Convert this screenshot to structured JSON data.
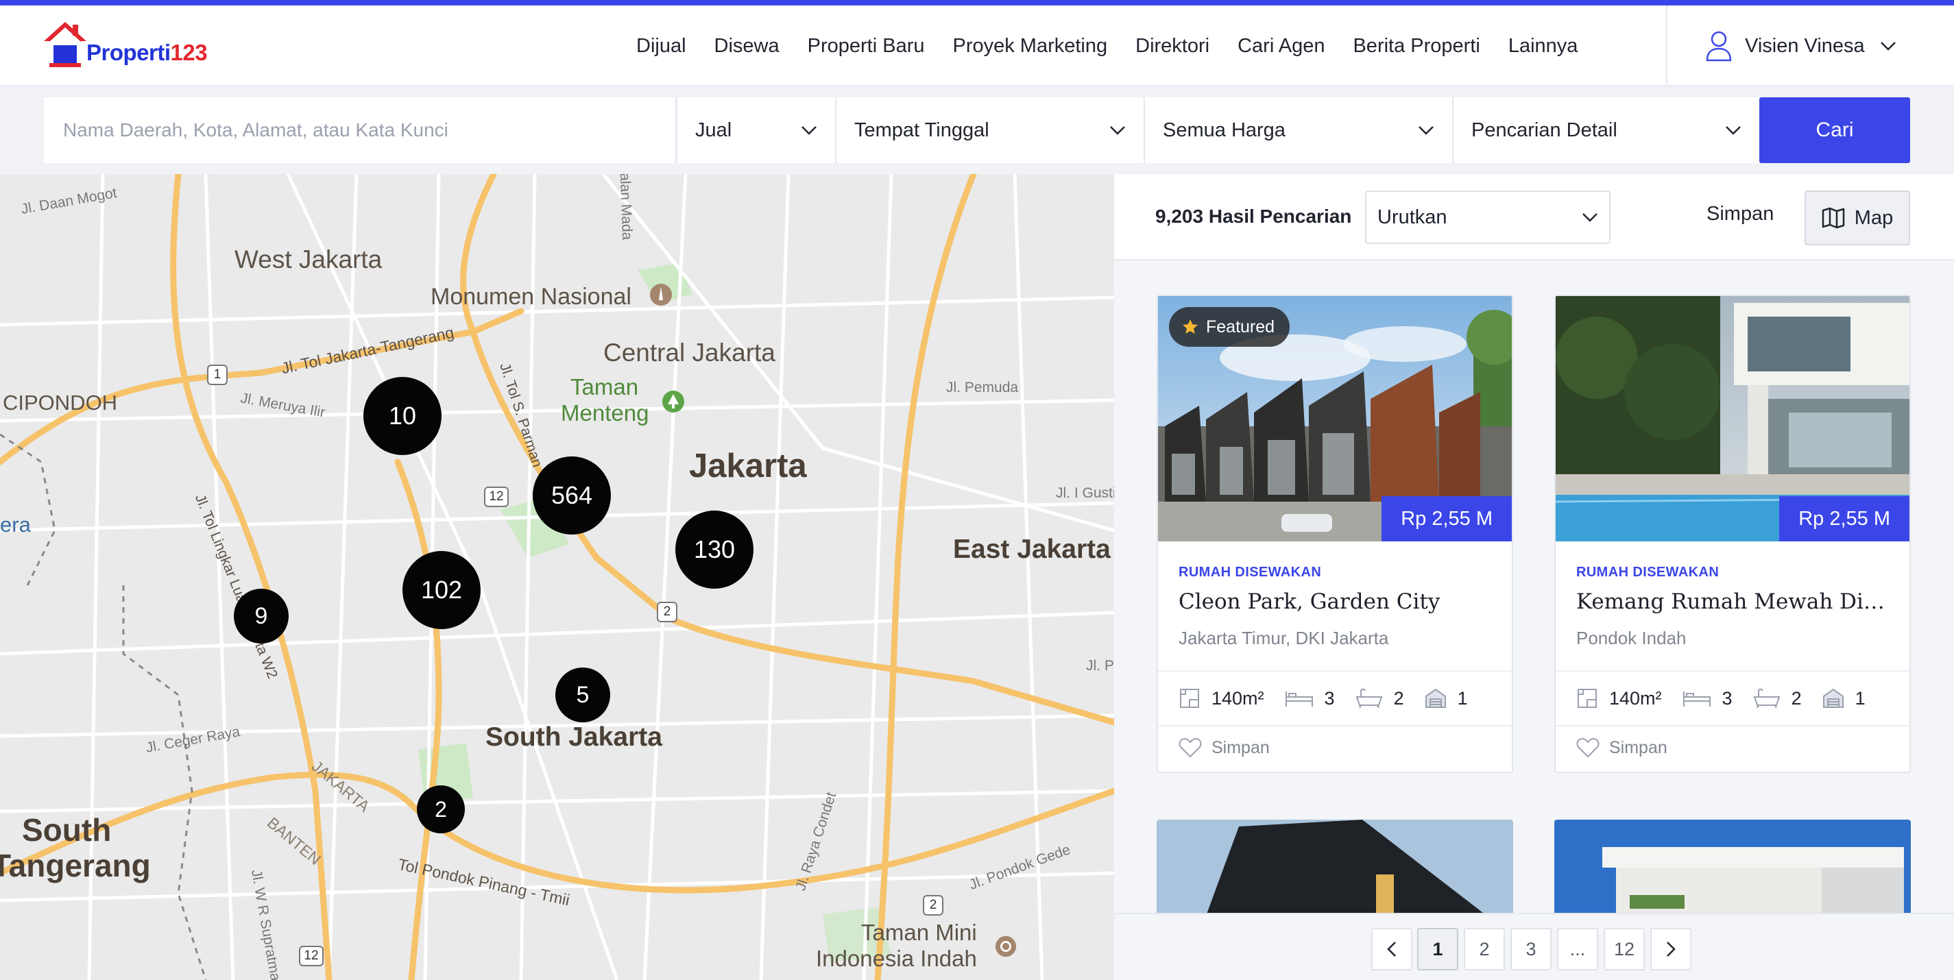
{
  "brand": {
    "logo_text_main": "Properti",
    "logo_text_num": "123"
  },
  "nav": {
    "items": [
      "Dijual",
      "Disewa",
      "Properti Baru",
      "Proyek Marketing",
      "Direktori",
      "Cari Agen",
      "Berita Properti",
      "Lainnya"
    ]
  },
  "user": {
    "name": "Visien Vinesa"
  },
  "search": {
    "placeholder": "Nama Daerah, Kota, Alamat, atau Kata Kunci",
    "type": "Jual",
    "category": "Tempat Tinggal",
    "price": "Semua Harga",
    "detail": "Pencarian Detail",
    "button": "Cari"
  },
  "map": {
    "labels": [
      "West Jakarta",
      "Monumen Nasional",
      "Central Jakarta",
      "Taman",
      "Menteng",
      "Jakarta",
      "East Jakarta",
      "CIPONDOH",
      "era",
      "South Jakarta",
      "South",
      "Tangerang",
      "Taman Mini",
      "Indonesia Indah",
      "Jl. Tol Jakarta-Tangerang",
      "Jl. Meruya Ilir",
      "Jl. Tol S. Parman",
      "Jl. Pemuda",
      "Jl. I Gusti",
      "Jl. Ceger Raya",
      "JAKARTA",
      "BANTEN",
      "Tol Pondok Pinang - Tmii",
      "Jl. Raya Condet",
      "Jl. Pondok Gede",
      "Jl. W R Supratman",
      "Jl. Daan Mogot",
      "Jl. Tol Lingkar Luar Jakarta W2",
      "Jl. Pr",
      "Jalan Mada"
    ],
    "road_shields": [
      "1",
      "12",
      "2",
      "2",
      "12"
    ],
    "clusters": [
      {
        "count": "10"
      },
      {
        "count": "564"
      },
      {
        "count": "130"
      },
      {
        "count": "102"
      },
      {
        "count": "9"
      },
      {
        "count": "5"
      },
      {
        "count": "2"
      }
    ]
  },
  "results": {
    "count": "9,203 Hasil Pencarian",
    "sort": "Urutkan",
    "save": "Simpan",
    "map_button": "Map"
  },
  "listings": [
    {
      "featured": "Featured",
      "price": "Rp 2,55 M",
      "type": "RUMAH DISEWAKAN",
      "title": "Cleon Park, Garden City",
      "location": "Jakarta Timur, DKI Jakarta",
      "area": "140m²",
      "beds": "3",
      "baths": "2",
      "garages": "1",
      "save": "Simpan"
    },
    {
      "featured": "",
      "price": "Rp 2,55 M",
      "type": "RUMAH DISEWAKAN",
      "title": "Kemang Rumah Mewah Dip...",
      "location": "Pondok Indah",
      "area": "140m²",
      "beds": "3",
      "baths": "2",
      "garages": "1",
      "save": "Simpan"
    }
  ],
  "pagination": {
    "pages": [
      "1",
      "2",
      "3",
      "...",
      "12"
    ],
    "current": "1"
  },
  "colors": {
    "accent": "#3b46e8",
    "cluster": "#050505",
    "road_major": "#f6c26a",
    "park": "#cde9c6"
  }
}
